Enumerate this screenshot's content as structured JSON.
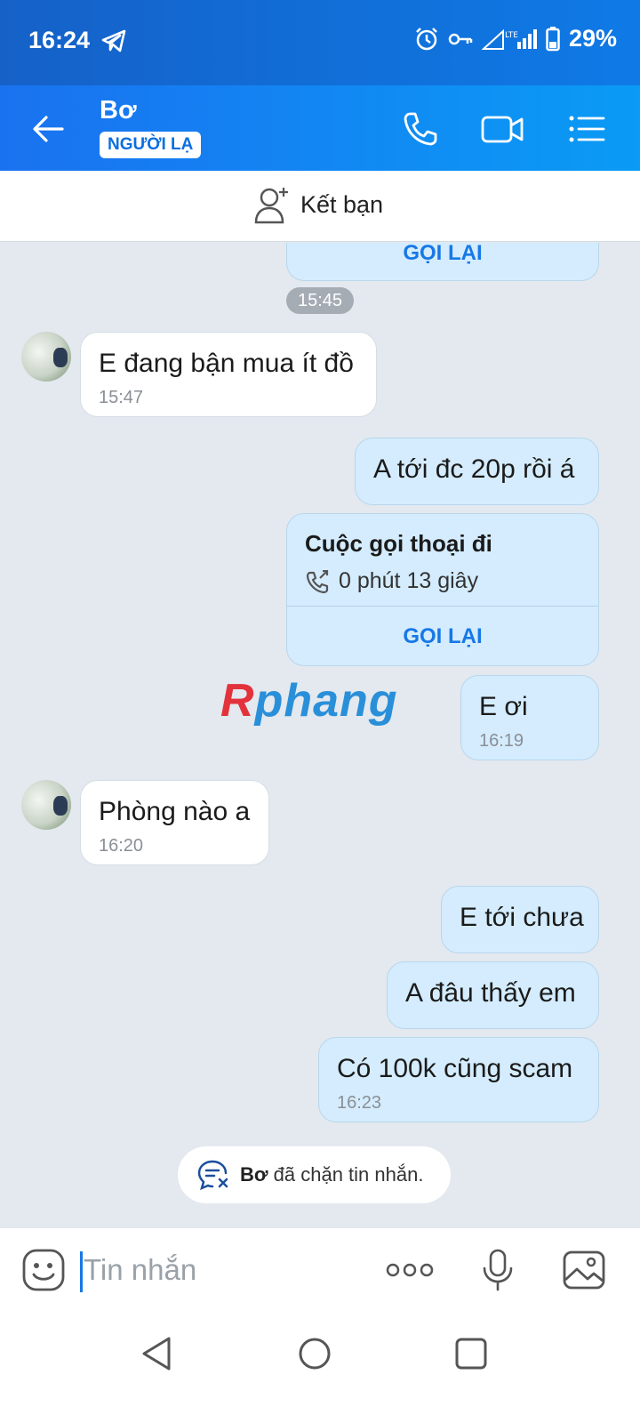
{
  "status": {
    "time": "16:24",
    "battery": "29%"
  },
  "header": {
    "name": "Bơ",
    "badge": "NGƯỜI LẠ"
  },
  "add_friend": {
    "label": "Kết bạn"
  },
  "chat": {
    "top_callback": "GỌI LẠI",
    "time_pill": "15:45",
    "messages": [
      {
        "text": "E đang bận mua ít đồ",
        "time": "15:47"
      },
      {
        "text": "A tới đc 20p rồi á"
      },
      {
        "call_title": "Cuộc gọi thoại đi",
        "call_duration": "0 phút 13 giây",
        "callback": "GỌI LẠI"
      },
      {
        "text": "E ơi",
        "time": "16:19"
      },
      {
        "text": "Phòng nào a",
        "time": "16:20"
      },
      {
        "text": "E tới chưa"
      },
      {
        "text": "A đâu thấy em"
      },
      {
        "text": "Có 100k cũng scam",
        "time": "16:23"
      }
    ],
    "watermark": {
      "first": "R",
      "rest": "phang"
    },
    "blocked": {
      "name": "Bơ",
      "text": " đã chặn tin nhắn."
    }
  },
  "input": {
    "placeholder": "Tin nhắn"
  },
  "colors": {
    "header": "#0a84ff",
    "outgoing": "#d4ecfd",
    "incoming": "#ffffff",
    "accent": "#1778e6"
  },
  "icons": [
    "back-arrow-icon",
    "phone-icon",
    "video-icon",
    "menu-icon",
    "add-user-icon",
    "call-out-icon",
    "message-blocked-icon",
    "emoji-icon",
    "more-icon",
    "mic-icon",
    "image-icon",
    "nav-back-icon",
    "nav-home-icon",
    "nav-recent-icon"
  ]
}
